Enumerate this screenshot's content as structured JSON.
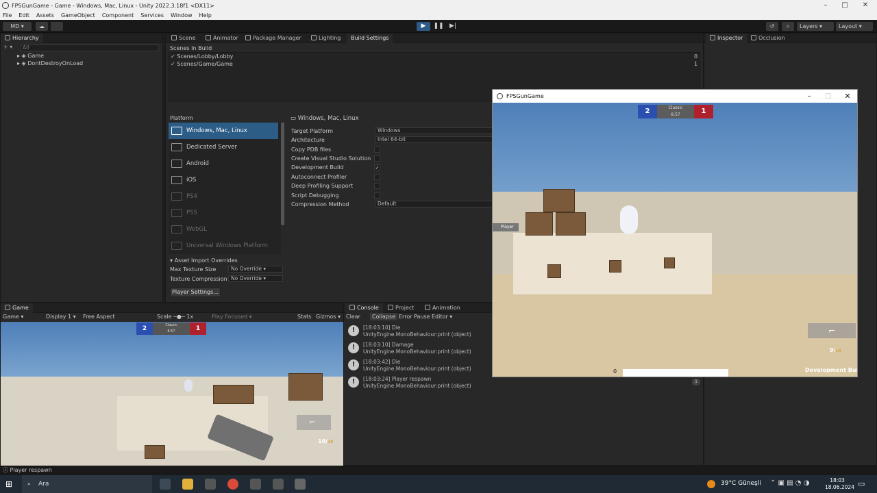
{
  "window": {
    "title": "FPSGunGame - Game - Windows, Mac, Linux - Unity 2022.3.18f1 <DX11>"
  },
  "menu": [
    "File",
    "Edit",
    "Assets",
    "GameObject",
    "Component",
    "Services",
    "Window",
    "Help"
  ],
  "toolbar": {
    "account": "MD",
    "layers": "Layers",
    "layout": "Layout"
  },
  "hierarchy": {
    "tab": "Hierarchy",
    "search_placeholder": "All",
    "items": [
      "Game",
      "DontDestroyOnLoad"
    ]
  },
  "build": {
    "tabs": [
      "Scene",
      "Animator",
      "Package Manager",
      "Lighting",
      "Build Settings"
    ],
    "scenes_header": "Scenes In Build",
    "scenes": [
      {
        "name": "Scenes/Lobby/Lobby",
        "index": "0"
      },
      {
        "name": "Scenes/Game/Game",
        "index": "1"
      }
    ],
    "platform_header": "Platform",
    "platforms": [
      "Windows, Mac, Linux",
      "Dedicated Server",
      "Android",
      "iOS",
      "PS4",
      "PS5",
      "WebGL",
      "Universal Windows Platform"
    ],
    "selected_title": "Windows, Mac, Linux",
    "settings": [
      {
        "label": "Target Platform",
        "value": "Windows"
      },
      {
        "label": "Architecture",
        "value": "Intel 64-bit"
      },
      {
        "label": "Copy PDB files",
        "value": ""
      },
      {
        "label": "Create Visual Studio Solution",
        "value": ""
      },
      {
        "label": "Development Build",
        "value": "✓"
      },
      {
        "label": "Autoconnect Profiler",
        "value": ""
      },
      {
        "label": "Deep Profiling Support",
        "value": ""
      },
      {
        "label": "Script Debugging",
        "value": ""
      },
      {
        "label": "Compression Method",
        "value": "Default"
      }
    ],
    "asset_overrides": "Asset Import Overrides",
    "max_texture_label": "Max Texture Size",
    "max_texture_value": "No Override",
    "texture_comp_label": "Texture Compression",
    "texture_comp_value": "No Override",
    "player_settings": "Player Settings..."
  },
  "inspector": {
    "tabs": [
      "Inspector",
      "Occlusion"
    ]
  },
  "game_window": {
    "title": "FPSGunGame",
    "score_blue": "2",
    "score_red": "1",
    "mode": "Classic",
    "timer": "8:57",
    "player_label": "Player",
    "ammo": "9",
    "ammo_total": "18",
    "health": "0",
    "dev_build": "Development Build"
  },
  "game_view": {
    "tab": "Game",
    "mode": "Game",
    "display": "Display 1",
    "aspect": "Free Aspect",
    "scale_label": "Scale",
    "scale_value": "1x",
    "play_focused": "Play Focused",
    "stats": "Stats",
    "gizmos": "Gizmos",
    "score_blue": "2",
    "score_red": "1",
    "mode_label": "Classic",
    "timer": "8:57",
    "ammo": "10",
    "ammo_total": "18"
  },
  "console": {
    "tabs": [
      "Console",
      "Project",
      "Animation"
    ],
    "toolbar": [
      "Clear",
      "Collapse",
      "Error Pause",
      "Editor"
    ],
    "logs": [
      {
        "line1": "[18:03:10] Die",
        "line2": "UnityEngine.MonoBehaviour:print (object)"
      },
      {
        "line1": "[18:03:10] Damage",
        "line2": "UnityEngine.MonoBehaviour:print (object)"
      },
      {
        "line1": "[18:03:42] Die",
        "line2": "UnityEngine.MonoBehaviour:print (object)"
      },
      {
        "line1": "[18:03:24] Player respawn",
        "line2": "UnityEngine.MonoBehaviour:print (object)"
      }
    ],
    "count": "1"
  },
  "statusbar": {
    "text": "Player respawn"
  },
  "taskbar": {
    "search": "Ara",
    "weather": "39°C Güneşli",
    "time": "18:03",
    "date": "18.06.2024"
  }
}
